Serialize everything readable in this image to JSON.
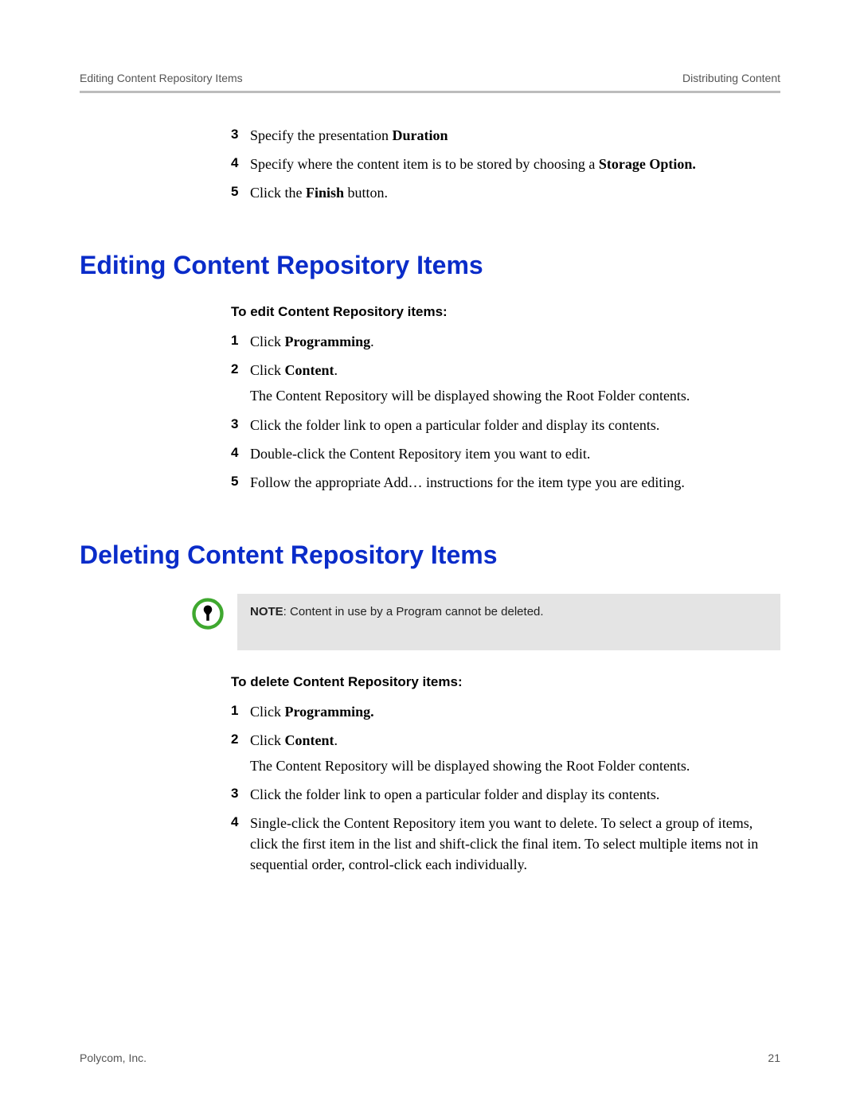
{
  "header": {
    "left": "Editing Content Repository Items",
    "right": "Distributing Content"
  },
  "intro_steps": [
    {
      "num": "3",
      "segments": [
        {
          "t": "Specify the presentation "
        },
        {
          "t": "Duration",
          "b": true
        }
      ]
    },
    {
      "num": "4",
      "segments": [
        {
          "t": "Specify where the content item is to be stored by choosing a "
        },
        {
          "t": "Storage Option.",
          "b": true
        }
      ]
    },
    {
      "num": "5",
      "segments": [
        {
          "t": "Click the "
        },
        {
          "t": "Finish",
          "b": true
        },
        {
          "t": " button."
        }
      ]
    }
  ],
  "section_edit": {
    "title": "Editing Content Repository Items",
    "subheading": "To edit Content Repository items:",
    "steps": [
      {
        "num": "1",
        "segments": [
          {
            "t": "Click "
          },
          {
            "t": "Programming",
            "b": true
          },
          {
            "t": "."
          }
        ]
      },
      {
        "num": "2",
        "segments": [
          {
            "t": "Click "
          },
          {
            "t": "Content",
            "b": true
          },
          {
            "t": "."
          }
        ],
        "sub": "The Content Repository will be displayed showing the Root Folder contents."
      },
      {
        "num": "3",
        "segments": [
          {
            "t": "Click the folder link to open a particular folder and display its contents."
          }
        ]
      },
      {
        "num": "4",
        "segments": [
          {
            "t": "Double-click the Content Repository item you want to edit."
          }
        ]
      },
      {
        "num": "5",
        "segments": [
          {
            "t": "Follow the appropriate Add… instructions for the item type you are editing."
          }
        ]
      }
    ]
  },
  "section_delete": {
    "title": "Deleting Content Repository Items",
    "note_label": "NOTE",
    "note_text": ": Content in use by a Program cannot be deleted.",
    "subheading": "To delete Content Repository items:",
    "steps": [
      {
        "num": "1",
        "segments": [
          {
            "t": "Click "
          },
          {
            "t": "Programming.",
            "b": true
          }
        ]
      },
      {
        "num": "2",
        "segments": [
          {
            "t": "Click "
          },
          {
            "t": "Content",
            "b": true
          },
          {
            "t": "."
          }
        ],
        "sub": "The Content Repository will be displayed showing the Root Folder contents."
      },
      {
        "num": "3",
        "segments": [
          {
            "t": "Click the folder link to open a particular folder and display its contents."
          }
        ]
      },
      {
        "num": "4",
        "segments": [
          {
            "t": "Single-click the Content Repository item you want to delete. To select a group of items, click the first item in the list and shift-click the final item. To select multiple items not in sequential order, control-click each individually."
          }
        ]
      }
    ]
  },
  "footer": {
    "left": "Polycom, Inc.",
    "right": "21"
  }
}
